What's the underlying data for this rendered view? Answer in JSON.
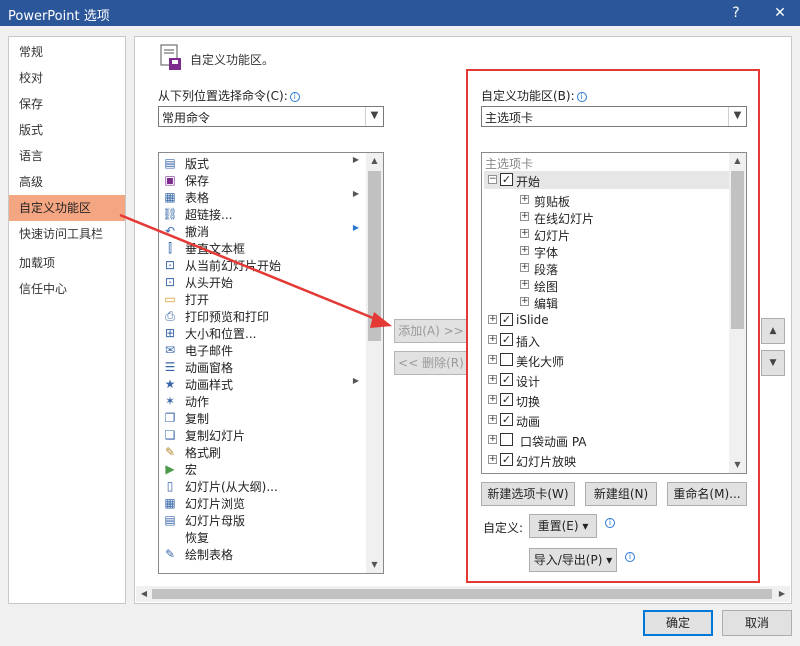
{
  "window": {
    "title": "PowerPoint 选项",
    "help_glyph": "?",
    "close_glyph": "✕"
  },
  "nav": {
    "items": [
      {
        "label": "常规"
      },
      {
        "label": "校对"
      },
      {
        "label": "保存"
      },
      {
        "label": "版式"
      },
      {
        "label": "语言"
      },
      {
        "label": "高级"
      },
      {
        "label": "自定义功能区",
        "active": true
      },
      {
        "label": "快速访问工具栏"
      },
      {
        "label": "加载项"
      },
      {
        "label": "信任中心"
      }
    ]
  },
  "header": {
    "title": "自定义功能区。",
    "icon": "ribbon-customize-icon"
  },
  "left_pane": {
    "choose_label": "从下列位置选择命令(C):",
    "choose_value": "常用命令",
    "commands": [
      {
        "label": "版式",
        "icon": "layout-icon",
        "submenu": true
      },
      {
        "label": "保存",
        "icon": "save-icon"
      },
      {
        "label": "表格",
        "icon": "table-icon",
        "submenu": true
      },
      {
        "label": "超链接...",
        "icon": "hyperlink-icon"
      },
      {
        "label": "撤消",
        "icon": "undo-icon",
        "submenu": true
      },
      {
        "label": "垂直文本框",
        "icon": "vertical-textbox-icon"
      },
      {
        "label": "从当前幻灯片开始",
        "icon": "slideshow-current-icon"
      },
      {
        "label": "从头开始",
        "icon": "slideshow-start-icon"
      },
      {
        "label": "打开",
        "icon": "open-folder-icon"
      },
      {
        "label": "打印预览和打印",
        "icon": "print-preview-icon"
      },
      {
        "label": "大小和位置...",
        "icon": "size-position-icon"
      },
      {
        "label": "电子邮件",
        "icon": "email-icon"
      },
      {
        "label": "动画窗格",
        "icon": "animation-pane-icon"
      },
      {
        "label": "动画样式",
        "icon": "animation-style-icon",
        "submenu": true
      },
      {
        "label": "动作",
        "icon": "action-icon"
      },
      {
        "label": "复制",
        "icon": "copy-icon"
      },
      {
        "label": "复制幻灯片",
        "icon": "duplicate-slide-icon"
      },
      {
        "label": "格式刷",
        "icon": "format-painter-icon"
      },
      {
        "label": "宏",
        "icon": "macro-icon"
      },
      {
        "label": "幻灯片(从大纲)...",
        "icon": "slides-from-outline-icon"
      },
      {
        "label": "幻灯片浏览",
        "icon": "slide-sorter-icon"
      },
      {
        "label": "幻灯片母版",
        "icon": "slide-master-icon"
      },
      {
        "label": "恢复",
        "icon": "redo-icon"
      },
      {
        "label": "绘制表格",
        "icon": "draw-table-icon"
      }
    ]
  },
  "middle": {
    "add_label": "添加(A) >>",
    "remove_label": "<< 删除(R)"
  },
  "right_pane": {
    "customize_label": "自定义功能区(B):",
    "customize_value": "主选项卡",
    "tree_header": "主选项卡",
    "tree": [
      {
        "label": "开始",
        "level": 0,
        "expander": "⊟",
        "checked": true
      },
      {
        "label": "剪贴板",
        "level": 1,
        "expander": "⊞"
      },
      {
        "label": "在线幻灯片",
        "level": 1,
        "expander": "⊞"
      },
      {
        "label": "幻灯片",
        "level": 1,
        "expander": "⊞"
      },
      {
        "label": "字体",
        "level": 1,
        "expander": "⊞"
      },
      {
        "label": "段落",
        "level": 1,
        "expander": "⊞"
      },
      {
        "label": "绘图",
        "level": 1,
        "expander": "⊞"
      },
      {
        "label": "编辑",
        "level": 1,
        "expander": "⊞"
      },
      {
        "label": "iSlide",
        "level": 0,
        "expander": "⊞",
        "checked": true
      },
      {
        "label": "插入",
        "level": 0,
        "expander": "⊞",
        "checked": true
      },
      {
        "label": "美化大师",
        "level": 0,
        "expander": "⊞",
        "checked": false
      },
      {
        "label": "设计",
        "level": 0,
        "expander": "⊞",
        "checked": true
      },
      {
        "label": "切换",
        "level": 0,
        "expander": "⊞",
        "checked": true
      },
      {
        "label": "动画",
        "level": 0,
        "expander": "⊞",
        "checked": true
      },
      {
        "label": "口袋动画 PA",
        "level": 0,
        "expander": "⊞",
        "checked": false
      },
      {
        "label": "幻灯片放映",
        "level": 0,
        "expander": "⊞",
        "checked": true
      }
    ],
    "new_tab_label": "新建选项卡(W)",
    "new_group_label": "新建组(N)",
    "rename_label": "重命名(M)...",
    "customize_text": "自定义:",
    "reset_label": "重置(E) ▾",
    "import_export_label": "导入/导出(P) ▾"
  },
  "footer": {
    "ok_label": "确定",
    "cancel_label": "取消"
  },
  "colors": {
    "title_bar": "#2b579a",
    "active_nav": "#f4a582",
    "annotation_red": "#e53935"
  }
}
